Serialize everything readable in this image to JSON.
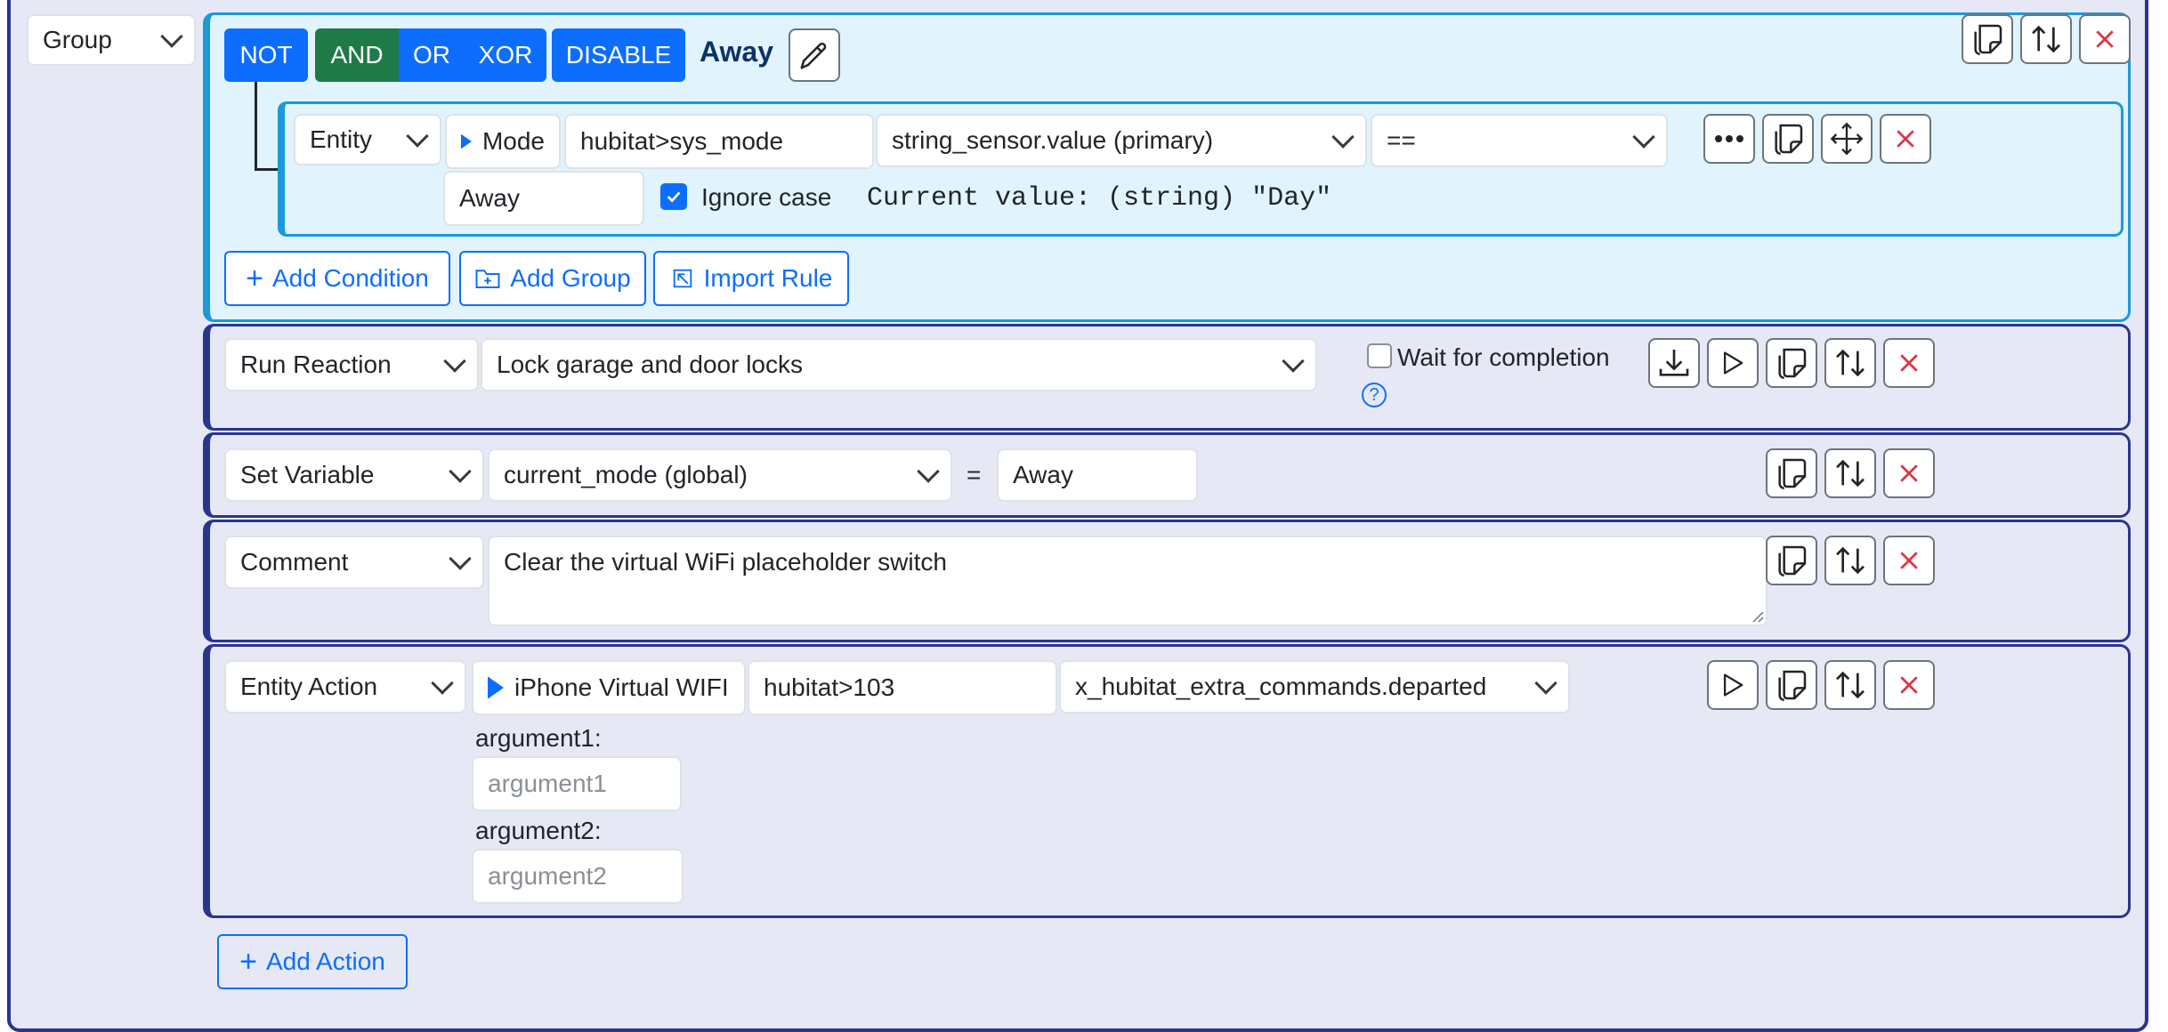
{
  "group": {
    "type_select": "Group",
    "ops": {
      "not": "NOT",
      "and": "AND",
      "or": "OR",
      "xor": "XOR",
      "disable": "DISABLE"
    },
    "name": "Away",
    "condition": {
      "type_select": "Entity",
      "entity_name": "Mode",
      "entity_id": "hubitat>sys_mode",
      "attribute": "string_sensor.value (primary)",
      "operator": "==",
      "value": "Away",
      "ignore_case_label": "Ignore case",
      "ignore_case_checked": true,
      "current_value": "Current value: (string) \"Day\""
    },
    "add_condition": "Add Condition",
    "add_group": "Add Group",
    "import_rule": "Import Rule"
  },
  "actions": {
    "run_reaction": {
      "type_select": "Run Reaction",
      "reaction": "Lock garage and door locks",
      "wait_label": "Wait for completion",
      "wait_checked": false
    },
    "set_variable": {
      "type_select": "Set Variable",
      "variable": "current_mode (global)",
      "equals": "=",
      "value": "Away"
    },
    "comment": {
      "type_select": "Comment",
      "text": "Clear the virtual WiFi placeholder switch"
    },
    "entity_action": {
      "type_select": "Entity Action",
      "entity_name": "iPhone Virtual WIFI",
      "entity_id": "hubitat>103",
      "command": "x_hubitat_extra_commands.departed",
      "arg1_label": "argument1:",
      "arg1_placeholder": "argument1",
      "arg2_label": "argument2:",
      "arg2_placeholder": "argument2"
    }
  },
  "add_action": "Add Action",
  "colors": {
    "primary": "#0d6efd",
    "and_active": "#1e7a47",
    "block_border": "#2a3590",
    "group_bg": "#e1f3fd",
    "group_border": "#1a9ad6",
    "delete_red": "#dc3545"
  }
}
